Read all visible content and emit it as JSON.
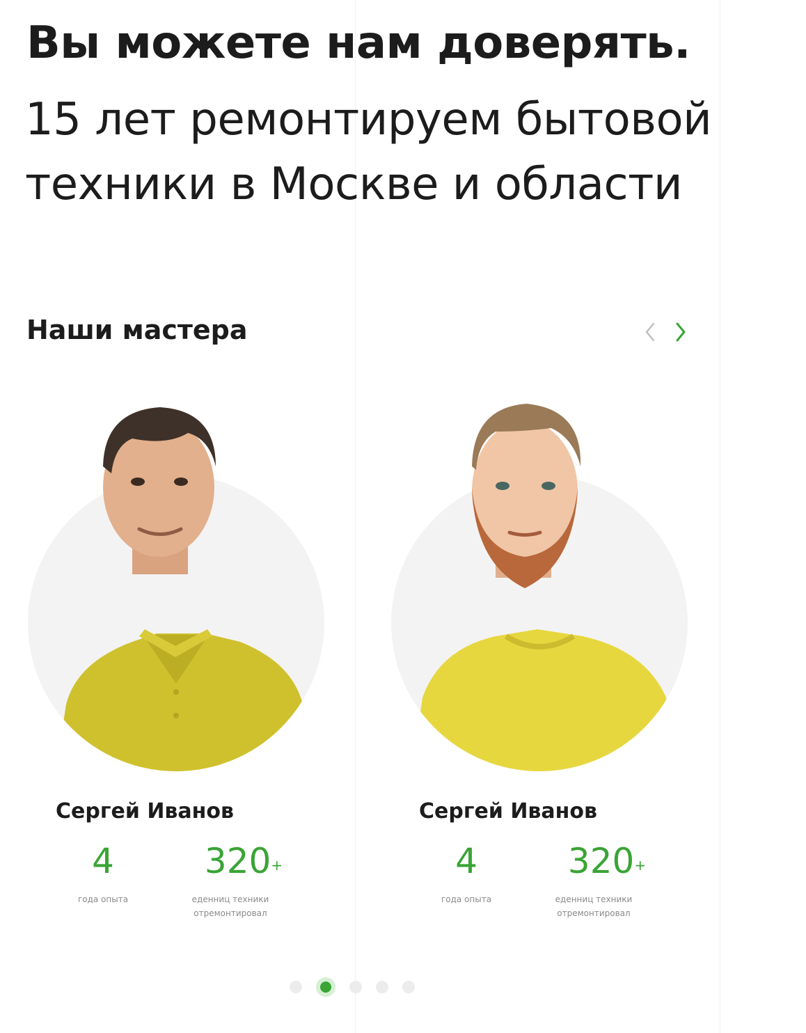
{
  "header": {
    "title": "Вы можете нам доверять.",
    "subtitle": "15 лет ремонтируем бытовой техники в Москве и области"
  },
  "masters": {
    "title": "Наши мастера",
    "items": [
      {
        "name": "Сергей Иванов",
        "years": "4",
        "years_label": "года опыта",
        "units": "320",
        "units_suffix": "+",
        "units_label": "еденниц техники отремонтировал"
      },
      {
        "name": "Сергей Иванов",
        "years": "4",
        "years_label": "года опыта",
        "units": "320",
        "units_suffix": "+",
        "units_label": "еденниц техники отремонтировал"
      }
    ],
    "pagination": {
      "count": 5,
      "active_index": 1
    }
  },
  "colors": {
    "accent": "#3aa435",
    "shirt": "#d9c93a",
    "circle_bg": "#f3f3f3"
  }
}
